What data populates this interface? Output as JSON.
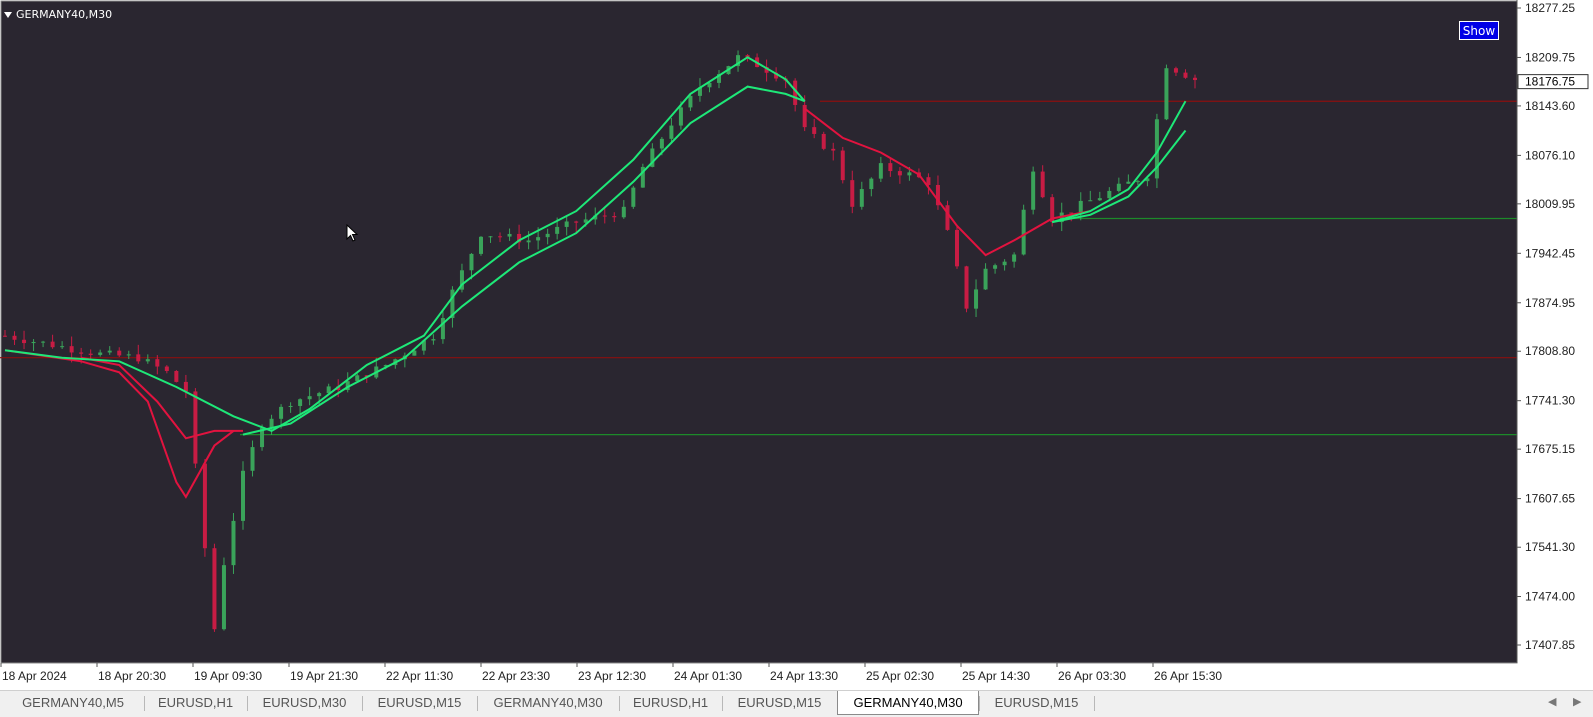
{
  "symbol": "GERMANY40,M30",
  "show_button": "Show",
  "colors": {
    "background": "#2a2630",
    "bull_candle": "#3aa35a",
    "bear_candle": "#c81c44",
    "ma_green": "#1ee878",
    "ma_red": "#e2133f",
    "resistance_line": "#8a0f0f",
    "support_line": "#1d8a2a"
  },
  "price_axis": {
    "ticks": [
      "18277.25",
      "18209.75",
      "18143.60",
      "18076.10",
      "18009.95",
      "17942.45",
      "17874.95",
      "17808.80",
      "17741.30",
      "17675.15",
      "17607.65",
      "17541.30",
      "17474.00",
      "17407.85"
    ],
    "current_price": "18176.75"
  },
  "time_axis": {
    "labels": [
      "18 Apr 2024",
      "18 Apr 20:30",
      "19 Apr 09:30",
      "19 Apr 21:30",
      "22 Apr 11:30",
      "22 Apr 23:30",
      "23 Apr 12:30",
      "24 Apr 01:30",
      "24 Apr 13:30",
      "25 Apr 02:30",
      "25 Apr 14:30",
      "26 Apr 03:30",
      "26 Apr 15:30"
    ]
  },
  "horizontal_lines": [
    {
      "price": 18150,
      "color": "red"
    },
    {
      "price": 17800,
      "color": "red"
    },
    {
      "price": 17990,
      "color": "green"
    },
    {
      "price": 17695,
      "color": "green"
    }
  ],
  "chart_data": {
    "type": "candlestick",
    "title": "GERMANY40,M30",
    "ylim": [
      17385,
      18277.25
    ],
    "x_labels": [
      "18 Apr 2024",
      "18 Apr 20:30",
      "19 Apr 09:30",
      "19 Apr 21:30",
      "22 Apr 11:30",
      "22 Apr 23:30",
      "23 Apr 12:30",
      "24 Apr 01:30",
      "24 Apr 13:30",
      "25 Apr 02:30",
      "25 Apr 14:30",
      "26 Apr 03:30",
      "26 Apr 15:30"
    ],
    "close_path": [
      [
        0,
        17830
      ],
      [
        6,
        17815
      ],
      [
        10,
        17805
      ],
      [
        14,
        17800
      ],
      [
        17,
        17780
      ],
      [
        19,
        17755
      ],
      [
        20,
        17650
      ],
      [
        22,
        17430
      ],
      [
        23,
        17520
      ],
      [
        25,
        17640
      ],
      [
        27,
        17710
      ],
      [
        30,
        17740
      ],
      [
        35,
        17760
      ],
      [
        40,
        17790
      ],
      [
        45,
        17830
      ],
      [
        47,
        17890
      ],
      [
        50,
        17970
      ],
      [
        55,
        17960
      ],
      [
        60,
        17985
      ],
      [
        65,
        18000
      ],
      [
        67,
        18060
      ],
      [
        70,
        18120
      ],
      [
        73,
        18170
      ],
      [
        77,
        18210
      ],
      [
        79,
        18200
      ],
      [
        82,
        18180
      ],
      [
        84,
        18110
      ],
      [
        87,
        18080
      ],
      [
        89,
        18010
      ],
      [
        92,
        18060
      ],
      [
        95,
        18050
      ],
      [
        97,
        18040
      ],
      [
        99,
        17970
      ],
      [
        101,
        17870
      ],
      [
        103,
        17920
      ],
      [
        106,
        17940
      ],
      [
        108,
        18060
      ],
      [
        110,
        17990
      ],
      [
        115,
        18020
      ],
      [
        120,
        18050
      ],
      [
        122,
        18200
      ],
      [
        125,
        18180
      ]
    ],
    "ma_fast_green": [
      [
        0,
        17810
      ],
      [
        6,
        17800
      ],
      [
        12,
        17795
      ],
      [
        18,
        17760
      ],
      [
        24,
        17720
      ],
      [
        28,
        17700
      ],
      [
        32,
        17730
      ],
      [
        38,
        17790
      ],
      [
        44,
        17830
      ],
      [
        48,
        17900
      ],
      [
        54,
        17960
      ],
      [
        60,
        18000
      ],
      [
        66,
        18070
      ],
      [
        72,
        18160
      ],
      [
        78,
        18210
      ],
      [
        82,
        18180
      ],
      [
        84,
        18150
      ]
    ],
    "ma_slow_green": [
      [
        25,
        17695
      ],
      [
        30,
        17710
      ],
      [
        36,
        17760
      ],
      [
        42,
        17800
      ],
      [
        48,
        17870
      ],
      [
        54,
        17930
      ],
      [
        60,
        17970
      ],
      [
        66,
        18040
      ],
      [
        72,
        18120
      ],
      [
        78,
        18170
      ],
      [
        82,
        18160
      ],
      [
        84,
        18150
      ]
    ],
    "ma_fast_red": [
      [
        0,
        17810
      ],
      [
        8,
        17795
      ],
      [
        12,
        17780
      ],
      [
        15,
        17740
      ],
      [
        18,
        17630
      ],
      [
        19,
        17610
      ],
      [
        22,
        17680
      ],
      [
        24,
        17700
      ]
    ],
    "ma_slow_red": [
      [
        8,
        17800
      ],
      [
        12,
        17790
      ],
      [
        16,
        17740
      ],
      [
        19,
        17690
      ],
      [
        22,
        17700
      ],
      [
        25,
        17700
      ]
    ],
    "ma_red_right": [
      [
        84,
        18140
      ],
      [
        88,
        18100
      ],
      [
        92,
        18080
      ],
      [
        96,
        18050
      ],
      [
        100,
        17980
      ],
      [
        103,
        17940
      ],
      [
        106,
        17960
      ],
      [
        110,
        17990
      ],
      [
        114,
        18000
      ]
    ],
    "ma_green_right_fast": [
      [
        110,
        17985
      ],
      [
        114,
        18000
      ],
      [
        118,
        18030
      ],
      [
        121,
        18080
      ],
      [
        124,
        18150
      ]
    ],
    "ma_green_right_slow": [
      [
        110,
        17985
      ],
      [
        114,
        17995
      ],
      [
        118,
        18020
      ],
      [
        121,
        18060
      ],
      [
        124,
        18110
      ]
    ]
  },
  "tabs": [
    {
      "label": "GERMANY40,M5",
      "active": false
    },
    {
      "label": "EURUSD,H1",
      "active": false
    },
    {
      "label": "EURUSD,M30",
      "active": false
    },
    {
      "label": "EURUSD,M15",
      "active": false
    },
    {
      "label": "GERMANY40,M30",
      "active": false
    },
    {
      "label": "EURUSD,H1",
      "active": false
    },
    {
      "label": "EURUSD,M15",
      "active": false
    },
    {
      "label": "GERMANY40,M30",
      "active": true
    },
    {
      "label": "EURUSD,M15",
      "active": false
    }
  ]
}
